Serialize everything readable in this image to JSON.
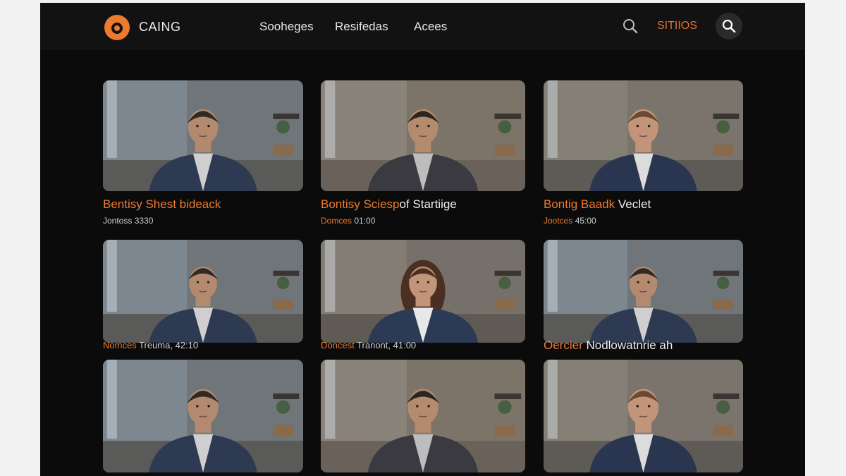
{
  "header": {
    "brand": "CAING",
    "nav": [
      "Sooheges",
      "Resifedas",
      "Acees"
    ],
    "sign_in": "SITIIOS",
    "accent_color": "#ee7a2e",
    "icons": [
      "logo-icon",
      "search-icon",
      "search-icon"
    ]
  },
  "videos": [
    {
      "title_accent": "Bentisy Shest bideack",
      "title_plain": "",
      "meta_accent": "",
      "meta_plain": "Jontoss  3330",
      "style": "gray-blue"
    },
    {
      "title_accent": "Bontisy Sciesp",
      "title_plain": "of Startiige",
      "meta_accent": "Domces",
      "meta_plain": "  01:00",
      "style": "warm"
    },
    {
      "title_accent": "Bontig Baadk",
      "title_plain": " Veclet",
      "meta_accent": "Jootces",
      "meta_plain": "  45:00",
      "style": "curly"
    },
    {
      "title_accent": "",
      "title_plain": "",
      "meta_accent": "Nomces",
      "meta_plain": "  Treuma,  42:10",
      "style": "gray-blue"
    },
    {
      "title_accent": "",
      "title_plain": "",
      "meta_accent": "Doncest",
      "meta_plain": "  Tranont,  41:00",
      "style": "woman"
    },
    {
      "title_accent": "Oercier",
      "title_plain": " Nodlowatnrie ah",
      "meta_accent": "",
      "meta_plain": "",
      "style": "gray-blue"
    },
    {
      "title_accent": "",
      "title_plain": "",
      "meta_accent": "",
      "meta_plain": "",
      "style": "gray-blue"
    },
    {
      "title_accent": "",
      "title_plain": "",
      "meta_accent": "",
      "meta_plain": "",
      "style": "warm"
    },
    {
      "title_accent": "",
      "title_plain": "",
      "meta_accent": "",
      "meta_plain": "",
      "style": "curly"
    }
  ]
}
